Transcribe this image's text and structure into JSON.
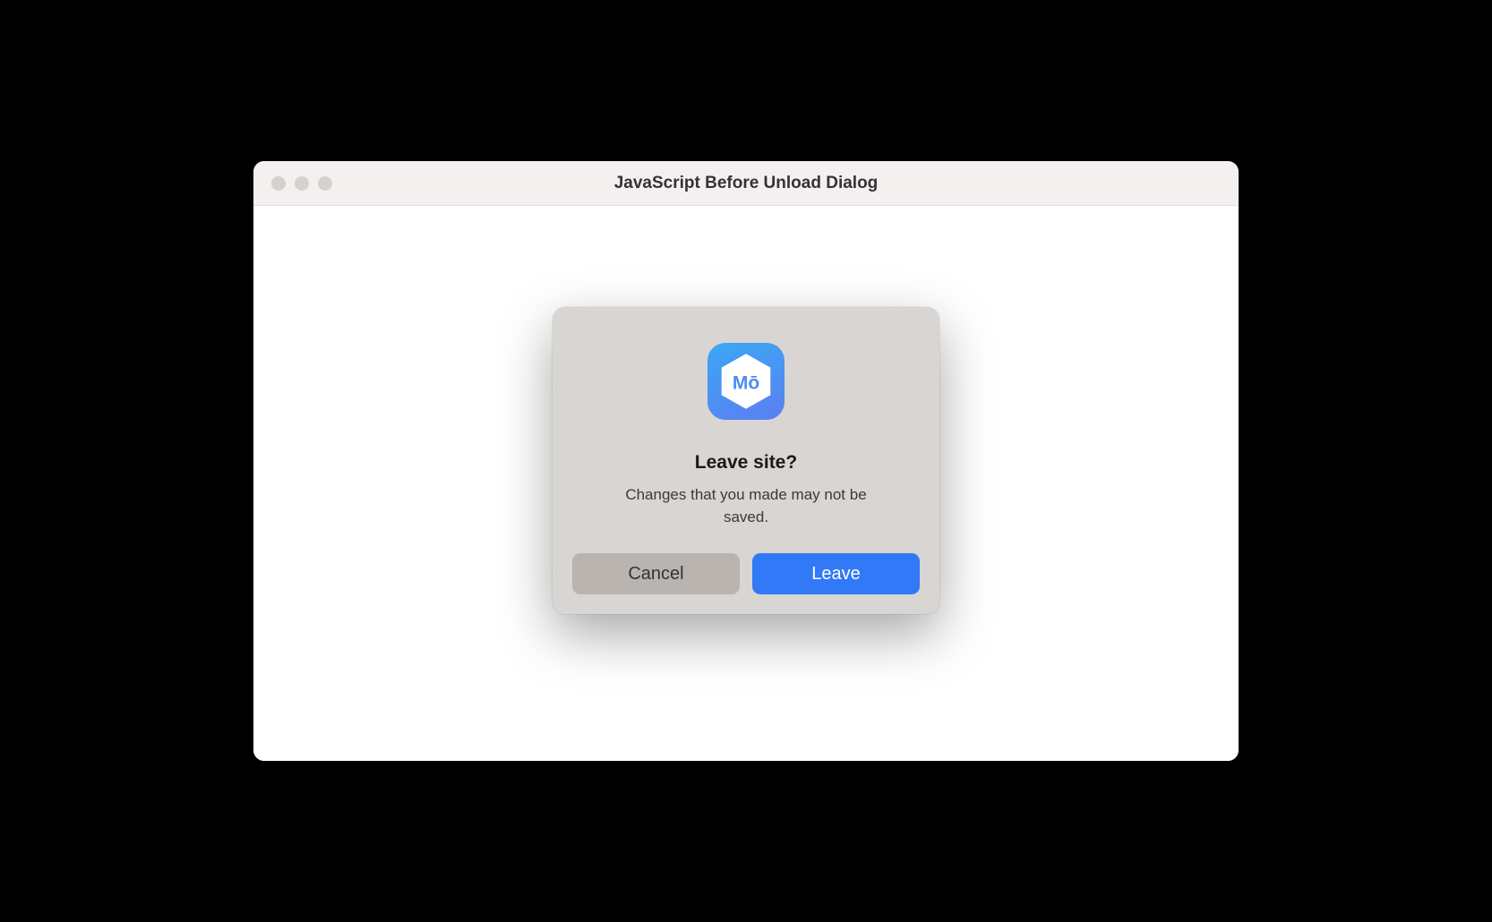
{
  "window": {
    "title": "JavaScript Before Unload Dialog"
  },
  "dialog": {
    "icon_text": "Mō",
    "heading": "Leave site?",
    "message": "Changes that you made may not be saved.",
    "cancel_label": "Cancel",
    "confirm_label": "Leave"
  },
  "colors": {
    "accent": "#3179f6",
    "icon_gradient_start": "#3aa9f4",
    "icon_gradient_end": "#5b7ef2"
  }
}
